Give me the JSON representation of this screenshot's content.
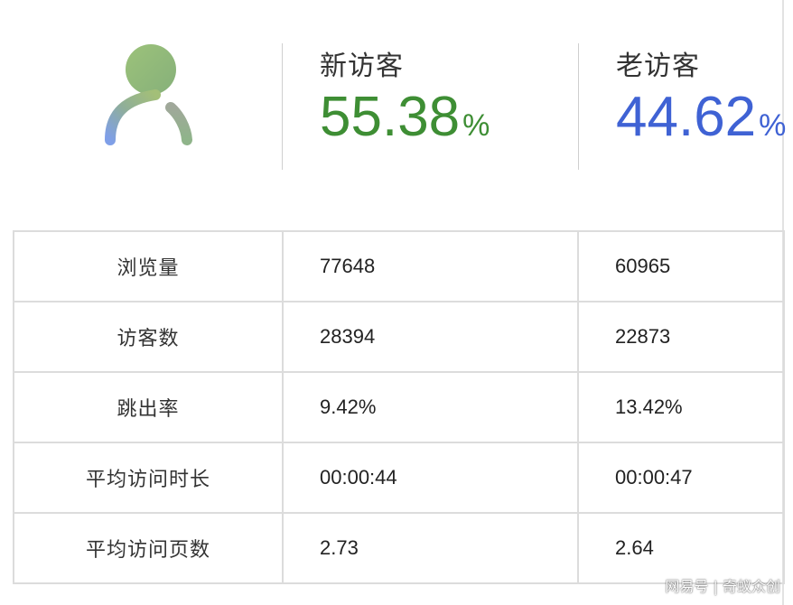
{
  "header": {
    "new_visitors": {
      "label": "新访客",
      "value": "55.38",
      "unit": "%",
      "color": "#3e8e34"
    },
    "returning_visitors": {
      "label": "老访客",
      "value": "44.62",
      "unit": "%",
      "color": "#3f62d4"
    },
    "avatar_icon": "user-gradient-icon"
  },
  "table": {
    "rows": [
      {
        "label": "浏览量",
        "new": "77648",
        "old": "60965"
      },
      {
        "label": "访客数",
        "new": "28394",
        "old": "22873"
      },
      {
        "label": "跳出率",
        "new": "9.42%",
        "old": "13.42%"
      },
      {
        "label": "平均访问时长",
        "new": "00:00:44",
        "old": "00:00:47"
      },
      {
        "label": "平均访问页数",
        "new": "2.73",
        "old": "2.64"
      }
    ]
  },
  "watermark": "网易号 | 奇蚁众创"
}
